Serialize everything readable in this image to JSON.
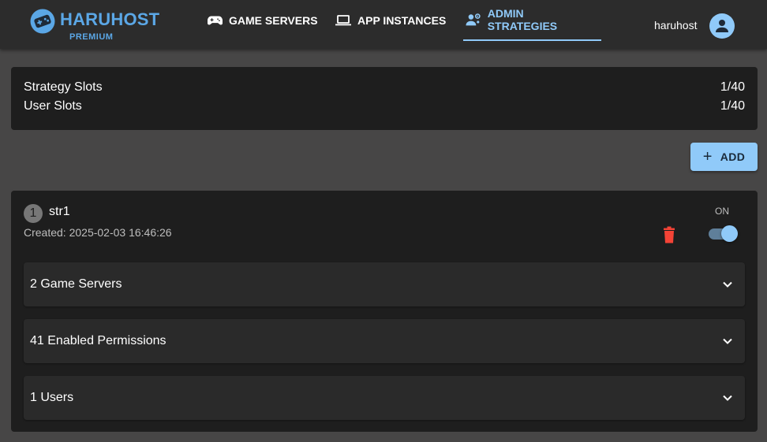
{
  "brand": {
    "name": "HARUHOST",
    "tier": "PREMIUM",
    "color": "#5ba7e6"
  },
  "nav": [
    {
      "label": "GAME SERVERS",
      "icon": "gamepad-icon"
    },
    {
      "label": "APP INSTANCES",
      "icon": "laptop-icon"
    },
    {
      "label": "ADMIN STRATEGIES",
      "icon": "admin-strategy-icon",
      "active": true
    }
  ],
  "user": {
    "name": "haruhost",
    "icon": "account-icon"
  },
  "slots": [
    {
      "label": "Strategy Slots",
      "value": "1/40"
    },
    {
      "label": "User Slots",
      "value": "1/40"
    }
  ],
  "add_button": {
    "label": "ADD",
    "icon": "plus-icon"
  },
  "strategy": {
    "index": "1",
    "name": "str1",
    "created": "Created: 2025-02-03 16:46:26",
    "switch_label": "ON",
    "enabled": true,
    "sections": [
      {
        "label": "2 Game Servers"
      },
      {
        "label": "41 Enabled Permissions"
      },
      {
        "label": "1 Users"
      }
    ]
  },
  "colors": {
    "accent": "#90caf9",
    "danger": "#f44336",
    "background": "#474646",
    "card": "#1e1e1e"
  }
}
